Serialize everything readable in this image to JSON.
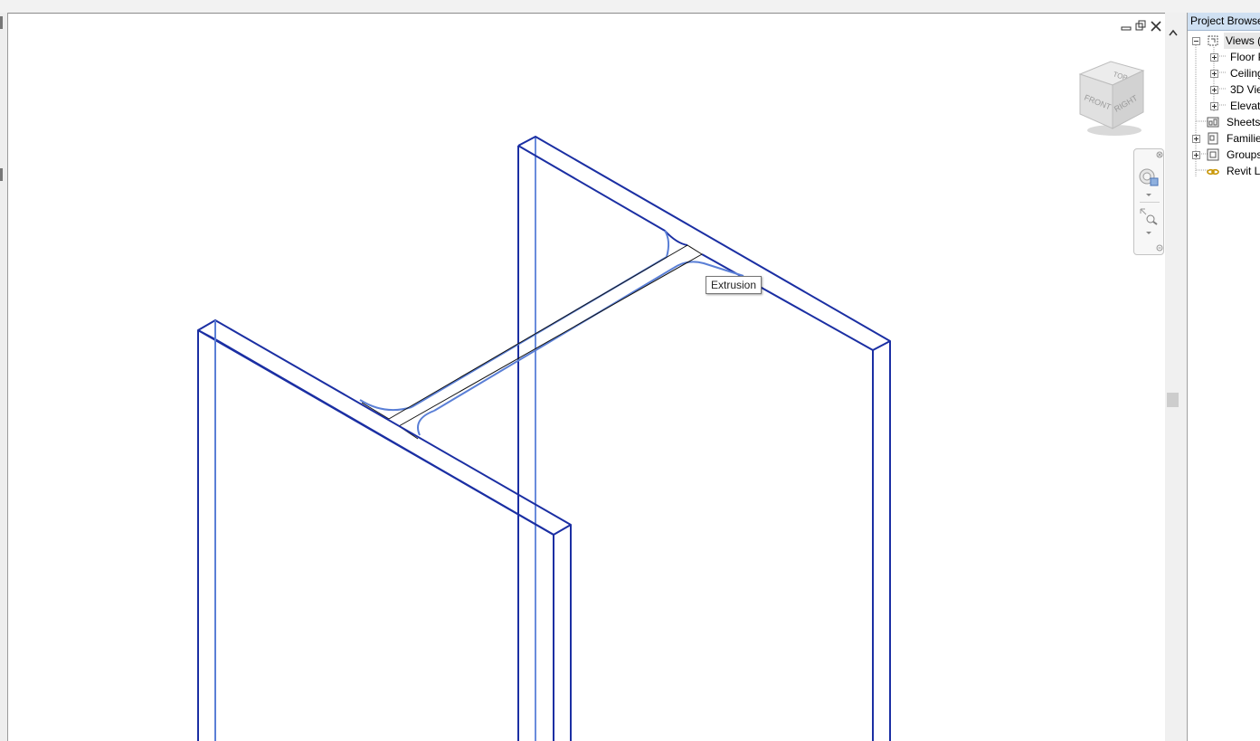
{
  "tooltip": {
    "text": "Extrusion"
  },
  "viewcube": {
    "top_label": "TOP",
    "front_label": "FRONT",
    "right_label": "RIGHT"
  },
  "project_browser": {
    "title": "Project Browser",
    "views": "Views (",
    "floor_plans": "Floor P",
    "ceiling_plans": "Ceiling",
    "views_3d": "3D Vie",
    "elevations": "Elevati",
    "sheets": "Sheets",
    "families": "Familie",
    "groups": "Groups",
    "revit_links": "Revit Li"
  },
  "colors": {
    "model_edge": "#1b2fa3",
    "hidden_edge": "#5a7fd6",
    "accent": "#cfe0f2"
  }
}
